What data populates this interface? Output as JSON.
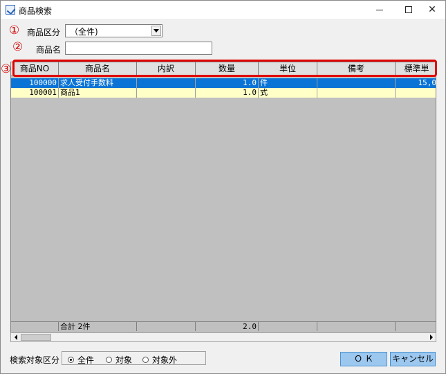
{
  "window": {
    "title": "商品検索",
    "minimize_icon": "minimize-icon",
    "maximize_icon": "maximize-icon",
    "close_label": "✕"
  },
  "markers": {
    "m1": "①",
    "m2": "②",
    "m3": "③"
  },
  "form": {
    "category_label": "商品区分",
    "category_value": "（全件)",
    "name_label": "商品名",
    "name_value": ""
  },
  "grid": {
    "columns": [
      "商品NO",
      "商品名",
      "内訳",
      "数量",
      "単位",
      "備考",
      "標準単"
    ],
    "rows": [
      {
        "no": "100000",
        "name": "求人受付手数料",
        "detail": "",
        "qty": "1.0",
        "unit": "件",
        "note": "",
        "price": "15,0",
        "selected": true
      },
      {
        "no": "100001",
        "name": "商品1",
        "detail": "",
        "qty": "1.0",
        "unit": "式",
        "note": "",
        "price": "",
        "selected": false
      }
    ],
    "total": {
      "label": "合計 2件",
      "qty": "2.0"
    }
  },
  "filter": {
    "label": "検索対象区分",
    "options": [
      "全件",
      "対象",
      "対象外"
    ],
    "selected": "全件"
  },
  "buttons": {
    "ok": "Ｏ Ｋ",
    "cancel": "キャンセル"
  },
  "colors": {
    "selected_row": "#0a74d6",
    "row_bg": "#ffffc8",
    "highlight": "#e00000",
    "button_bg": "#9cc8f0"
  }
}
